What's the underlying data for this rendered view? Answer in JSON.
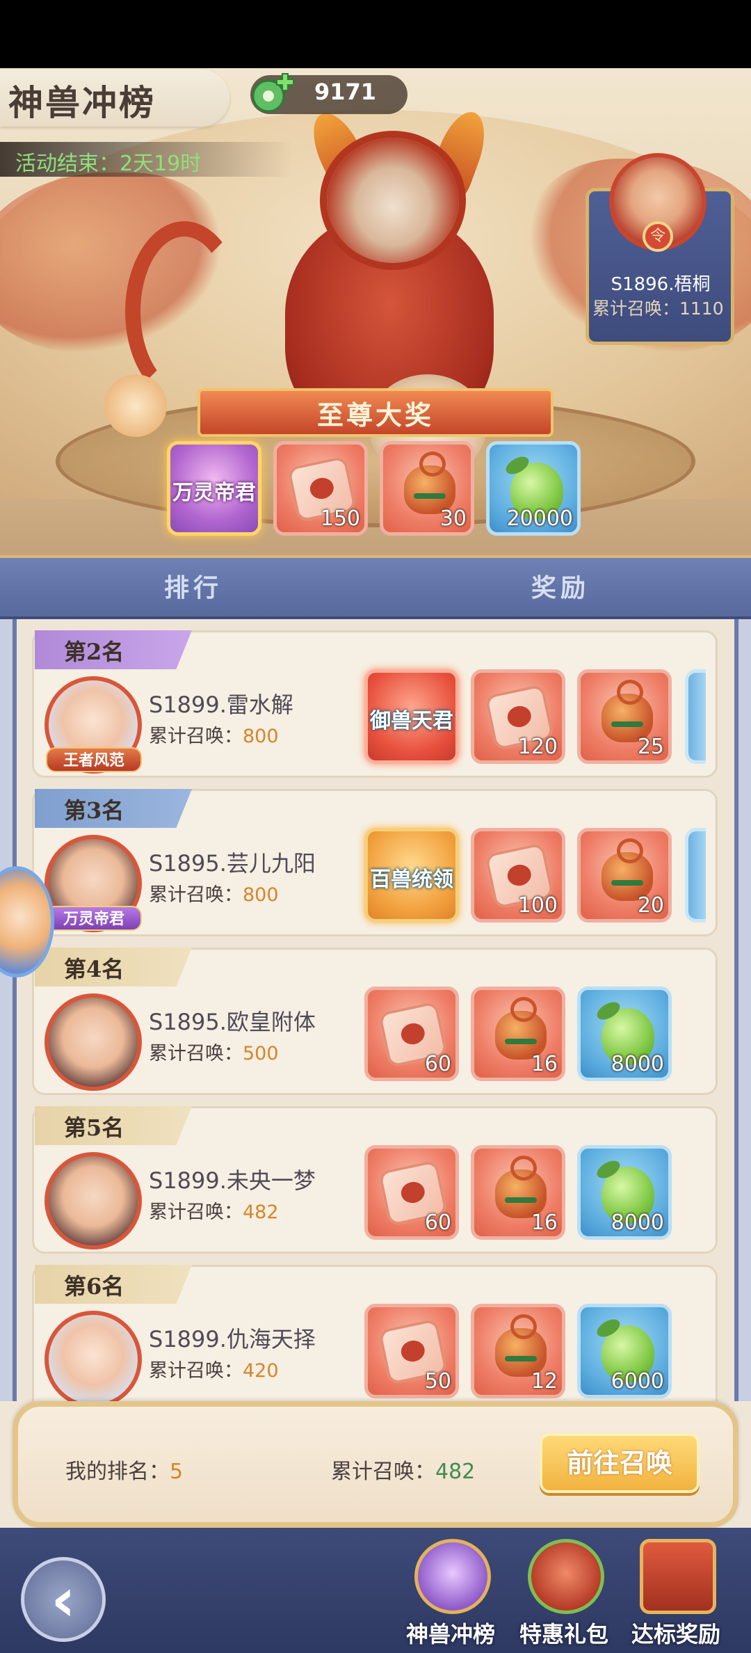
{
  "header": {
    "title": "神兽冲榜",
    "currency_value": "9171",
    "countdown": "活动结束：2天19时"
  },
  "top_player": {
    "name": "S1896.梧桐",
    "summon_text": "累计召唤：1110"
  },
  "grand_prize": {
    "label": "至尊大奖",
    "items": [
      {
        "name": "万灵帝君",
        "icon": "title-frame",
        "qty": ""
      },
      {
        "name": "",
        "icon": "puzzle-piece-icon",
        "qty": "150"
      },
      {
        "name": "",
        "icon": "bell-icon",
        "qty": "30"
      },
      {
        "name": "",
        "icon": "green-fruit-icon",
        "qty": "20000"
      }
    ]
  },
  "tabs": {
    "rank": "排行",
    "reward": "奖励"
  },
  "ranking": [
    {
      "rank": "第2名",
      "avatar_title": "王者风范",
      "player": "S1899.雷水解",
      "summon_label": "累计召唤：",
      "summon_value": "800",
      "rewards": [
        {
          "tag": "御兽天君",
          "qty": ""
        },
        {
          "tag": "",
          "qty": "120"
        },
        {
          "tag": "",
          "qty": "25"
        }
      ]
    },
    {
      "rank": "第3名",
      "avatar_title": "万灵帝君",
      "player": "S1895.芸儿九阳",
      "summon_label": "累计召唤：",
      "summon_value": "800",
      "rewards": [
        {
          "tag": "百兽统领",
          "qty": ""
        },
        {
          "tag": "",
          "qty": "100"
        },
        {
          "tag": "",
          "qty": "20"
        }
      ]
    },
    {
      "rank": "第4名",
      "avatar_title": "",
      "player": "S1895.欧皇附体",
      "summon_label": "累计召唤：",
      "summon_value": "500",
      "rewards": [
        {
          "tag": "",
          "qty": "60"
        },
        {
          "tag": "",
          "qty": "16"
        },
        {
          "tag": "",
          "qty": "8000"
        }
      ]
    },
    {
      "rank": "第5名",
      "avatar_title": "",
      "player": "S1899.未央一梦",
      "summon_label": "累计召唤：",
      "summon_value": "482",
      "rewards": [
        {
          "tag": "",
          "qty": "60"
        },
        {
          "tag": "",
          "qty": "16"
        },
        {
          "tag": "",
          "qty": "8000"
        }
      ]
    },
    {
      "rank": "第6名",
      "avatar_title": "",
      "player": "S1899.仇海天择",
      "summon_label": "累计召唤：",
      "summon_value": "420",
      "rewards": [
        {
          "tag": "",
          "qty": "50"
        },
        {
          "tag": "",
          "qty": "12"
        },
        {
          "tag": "",
          "qty": "6000"
        }
      ]
    }
  ],
  "my_stats": {
    "rank_label": "我的排名：",
    "rank_value": "5",
    "summon_label": "累计召唤：",
    "summon_value": "482",
    "go_button": "前往召唤"
  },
  "nav": {
    "items": [
      {
        "label": "神兽冲榜",
        "icon": "beast-ranking-icon"
      },
      {
        "label": "特惠礼包",
        "icon": "gift-pack-icon"
      },
      {
        "label": "达标奖励",
        "icon": "treasure-chest-icon"
      }
    ]
  }
}
